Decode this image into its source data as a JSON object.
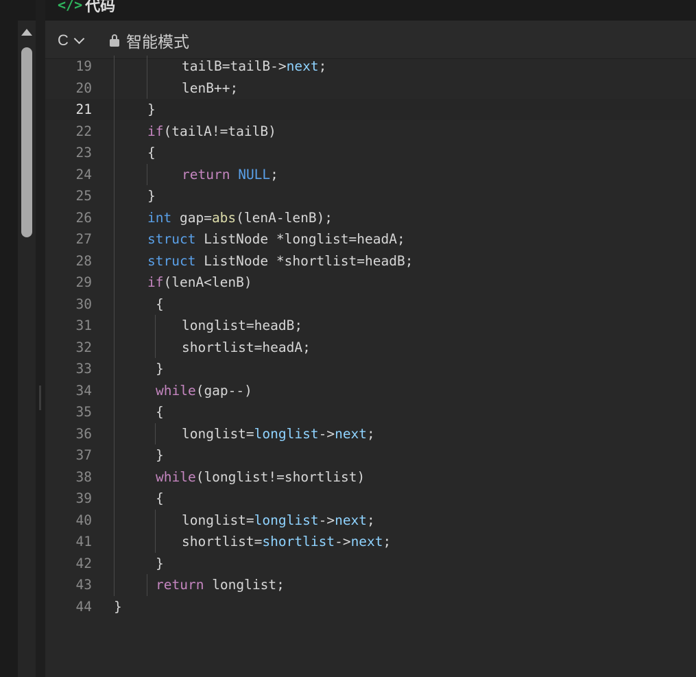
{
  "header": {
    "tag_symbol": "</>",
    "title": "代码"
  },
  "toolbar": {
    "language": "C",
    "mode_label": "智能模式"
  },
  "editor": {
    "active_line": 21,
    "lines": [
      {
        "n": "19",
        "indent": 4,
        "tokens": [
          [
            "tailB=",
            ""
          ],
          [
            "tailB",
            ""
          ],
          [
            "->",
            ""
          ],
          [
            "next",
            "pr"
          ],
          [
            ";",
            ""
          ]
        ]
      },
      {
        "n": "20",
        "indent": 4,
        "tokens": [
          [
            "lenB++;",
            ""
          ]
        ]
      },
      {
        "n": "21",
        "indent": 2,
        "tokens": [
          [
            "}",
            ""
          ]
        ]
      },
      {
        "n": "22",
        "indent": 2,
        "tokens": [
          [
            "if",
            "kw"
          ],
          [
            "(tailA!=tailB)",
            ""
          ]
        ]
      },
      {
        "n": "23",
        "indent": 2,
        "tokens": [
          [
            "{",
            ""
          ]
        ]
      },
      {
        "n": "24",
        "indent": 4,
        "tokens": [
          [
            "return",
            "kw"
          ],
          [
            " ",
            ""
          ],
          [
            "NULL",
            "cn"
          ],
          [
            ";",
            ""
          ]
        ]
      },
      {
        "n": "25",
        "indent": 2,
        "tokens": [
          [
            "}",
            ""
          ]
        ]
      },
      {
        "n": "26",
        "indent": 2,
        "tokens": [
          [
            "int",
            "ty"
          ],
          [
            " gap=",
            ""
          ],
          [
            "abs",
            "fn"
          ],
          [
            "(lenA-lenB);",
            ""
          ]
        ]
      },
      {
        "n": "27",
        "indent": 2,
        "tokens": [
          [
            "struct",
            "ty"
          ],
          [
            " ListNode *longlist=headA;",
            ""
          ]
        ]
      },
      {
        "n": "28",
        "indent": 2,
        "tokens": [
          [
            "struct",
            "ty"
          ],
          [
            " ListNode *shortlist=headB;",
            ""
          ]
        ]
      },
      {
        "n": "29",
        "indent": 2,
        "tokens": [
          [
            "if",
            "kw"
          ],
          [
            "(lenA<lenB)",
            ""
          ]
        ]
      },
      {
        "n": "30",
        "indent": 3,
        "tokens": [
          [
            "{",
            ""
          ]
        ]
      },
      {
        "n": "31",
        "indent": 4,
        "tokens": [
          [
            "longlist=headB;",
            ""
          ]
        ]
      },
      {
        "n": "32",
        "indent": 4,
        "tokens": [
          [
            "shortlist=headA;",
            ""
          ]
        ]
      },
      {
        "n": "33",
        "indent": 3,
        "tokens": [
          [
            "}",
            ""
          ]
        ]
      },
      {
        "n": "34",
        "indent": 3,
        "tokens": [
          [
            "while",
            "kw"
          ],
          [
            "(gap--)",
            ""
          ]
        ]
      },
      {
        "n": "35",
        "indent": 3,
        "tokens": [
          [
            "{",
            ""
          ]
        ]
      },
      {
        "n": "36",
        "indent": 4,
        "tokens": [
          [
            "longlist=",
            ""
          ],
          [
            "longlist",
            "pr"
          ],
          [
            "->",
            ""
          ],
          [
            "next",
            "pr"
          ],
          [
            ";",
            ""
          ]
        ]
      },
      {
        "n": "37",
        "indent": 3,
        "tokens": [
          [
            "}",
            ""
          ]
        ]
      },
      {
        "n": "38",
        "indent": 3,
        "tokens": [
          [
            "while",
            "kw"
          ],
          [
            "(longlist!=shortlist)",
            ""
          ]
        ]
      },
      {
        "n": "39",
        "indent": 3,
        "tokens": [
          [
            "{",
            ""
          ]
        ]
      },
      {
        "n": "40",
        "indent": 4,
        "tokens": [
          [
            "longlist=",
            ""
          ],
          [
            "longlist",
            "pr"
          ],
          [
            "->",
            ""
          ],
          [
            "next",
            "pr"
          ],
          [
            ";",
            ""
          ]
        ]
      },
      {
        "n": "41",
        "indent": 4,
        "tokens": [
          [
            "shortlist=",
            ""
          ],
          [
            "shortlist",
            "pr"
          ],
          [
            "->",
            ""
          ],
          [
            "next",
            "pr"
          ],
          [
            ";",
            ""
          ]
        ]
      },
      {
        "n": "42",
        "indent": 3,
        "tokens": [
          [
            "}",
            ""
          ]
        ]
      },
      {
        "n": "43",
        "indent": 3,
        "tokens": [
          [
            "return",
            "kw"
          ],
          [
            " longlist;",
            ""
          ]
        ]
      },
      {
        "n": "44",
        "indent": 0,
        "tokens": [
          [
            "}",
            ""
          ]
        ]
      }
    ]
  },
  "colors": {
    "keyword": "#c586c0",
    "type": "#5aa0e8",
    "function": "#dcdcaa",
    "property": "#8fd3ff",
    "tag_green": "#2fb55d"
  }
}
